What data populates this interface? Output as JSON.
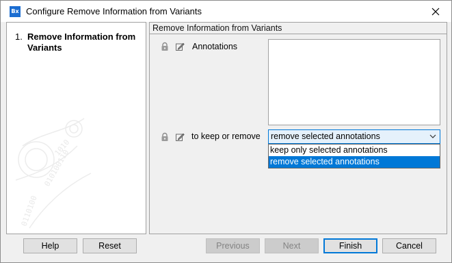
{
  "window": {
    "app_icon_text": "Bx",
    "title": "Configure Remove Information from Variants",
    "close_glyph": "✕"
  },
  "steps": [
    {
      "number": "1.",
      "label": "Remove Information from Variants"
    }
  ],
  "section": {
    "header": "Remove Information from Variants",
    "fields": {
      "annotations_label": "Annotations",
      "annotations_value": "",
      "keep_remove_label": "to keep or remove",
      "keep_remove_value": "remove selected annotations",
      "keep_remove_options": [
        "keep only selected annotations",
        "remove selected annotations"
      ],
      "keep_remove_highlighted": 1
    }
  },
  "buttons": {
    "help": "Help",
    "reset": "Reset",
    "previous": "Previous",
    "next": "Next",
    "finish": "Finish",
    "cancel": "Cancel"
  },
  "icons": {
    "lock": "lock-icon",
    "edit": "edit-pencil-icon",
    "chevron": "chevron-down-icon",
    "close": "close-icon"
  },
  "colors": {
    "accent": "#0078d7",
    "select_bg": "#e5f1fb",
    "disabled_text": "#838383"
  }
}
